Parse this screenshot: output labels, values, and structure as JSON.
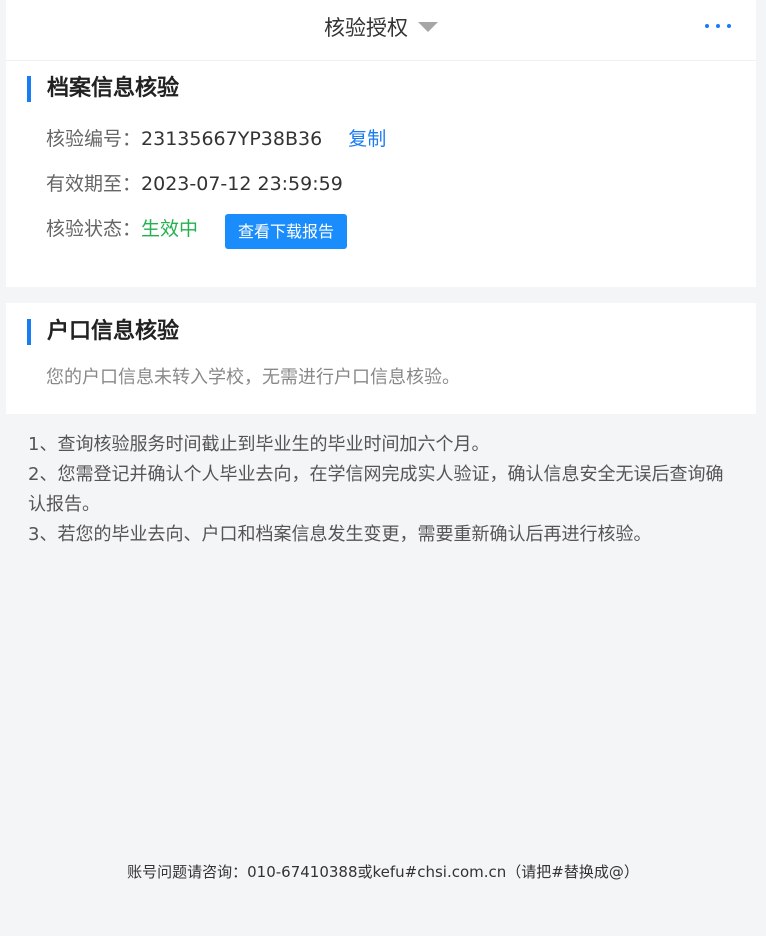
{
  "header": {
    "title": "核验授权",
    "caret_icon": "caret-down-icon",
    "more_icon": "more-dots-icon",
    "accent_color": "#1a7cf2"
  },
  "archive": {
    "title": "档案信息核验",
    "code_label": "核验编号：",
    "code_value": "23135667YP38B36",
    "copy_label": "复制",
    "expire_label": "有效期至：",
    "expire_value": "2023-07-12 23:59:59",
    "status_label": "核验状态：",
    "status_value": "生效中",
    "status_color": "#22b14c",
    "report_button": "查看下载报告"
  },
  "hukou": {
    "title": "户口信息核验",
    "message": "您的户口信息未转入学校，无需进行户口信息核验。"
  },
  "notes": [
    "1、查询核验服务时间截止到毕业生的毕业时间加六个月。",
    "2、您需登记并确认个人毕业去向，在学信网完成实人验证，确认信息安全无误后查询确认报告。",
    "3、若您的毕业去向、户口和档案信息发生变更，需要重新确认后再进行核验。"
  ],
  "footer": {
    "contact": "账号问题请咨询：010-67410388或kefu#chsi.com.cn（请把#替换成@）"
  }
}
